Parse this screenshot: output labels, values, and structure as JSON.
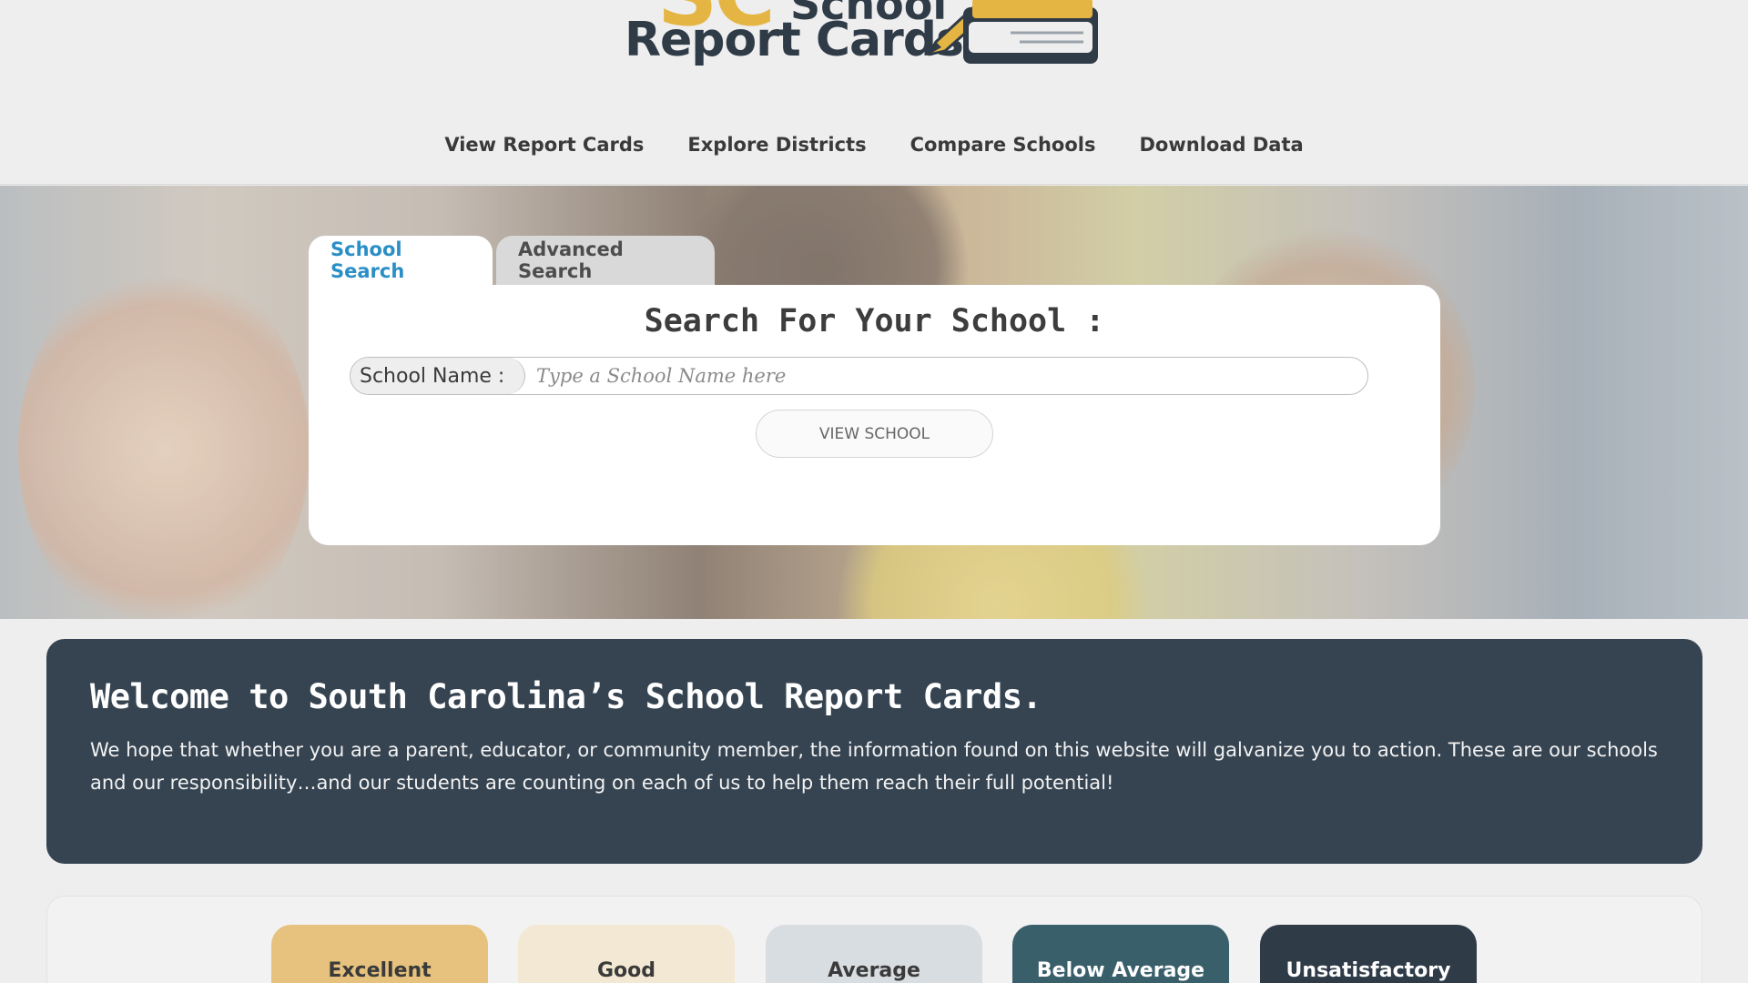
{
  "logo": {
    "sc": "SC",
    "school": "School",
    "report_cards": "Report Cards"
  },
  "nav": {
    "items": [
      "View Report Cards",
      "Explore Districts",
      "Compare Schools",
      "Download Data"
    ]
  },
  "search": {
    "tabs": [
      "School Search",
      "Advanced Search"
    ],
    "active_tab": "School Search",
    "title": "Search For Your School :",
    "field_label": "School Name :",
    "placeholder": "Type a School Name here",
    "value": "",
    "button_label": "VIEW SCHOOL"
  },
  "welcome": {
    "heading": "Welcome to South Carolina’s School Report Cards.",
    "body": "We hope that whether you are a parent, educator, or community member, the information found on this website will galvanize you to action. These are our schools and our responsibility…and our students are counting on each of us to help them reach their full potential!"
  },
  "ratings": {
    "labels": [
      "Excellent",
      "Good",
      "Average",
      "Below Average",
      "Unsatisfactory"
    ]
  },
  "colors": {
    "accent_blue": "#2a8fc6",
    "dark_slate": "#364452",
    "excellent": "#e6c27e",
    "good": "#f3e8d3",
    "average": "#d8dde2",
    "below_average": "#395f6b",
    "unsatisfactory": "#2f3b47"
  }
}
